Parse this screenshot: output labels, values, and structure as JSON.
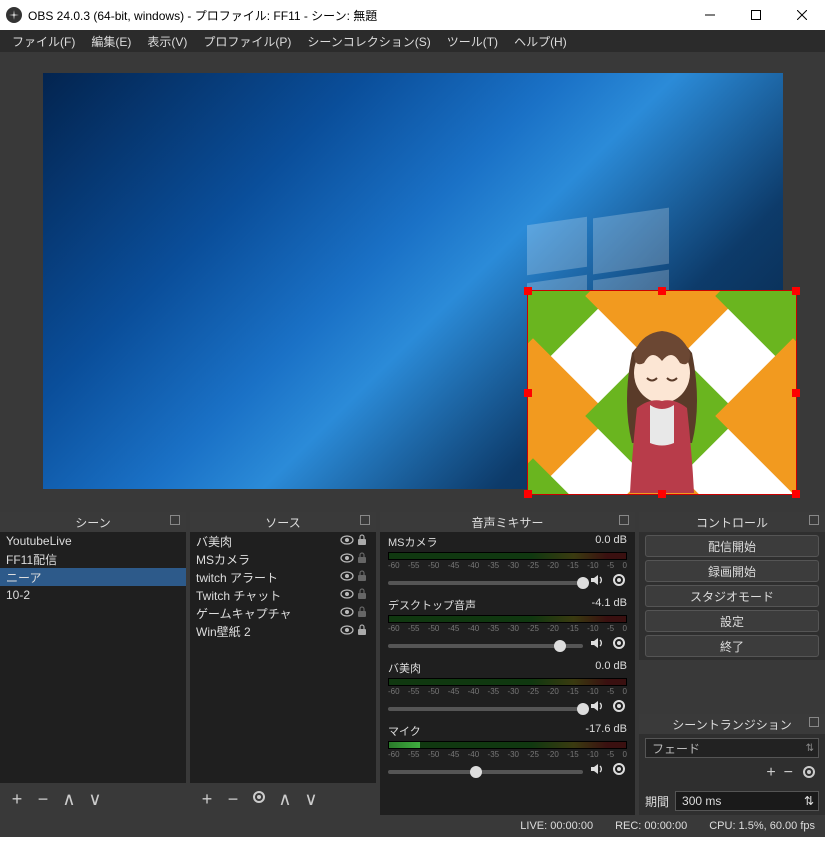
{
  "window": {
    "title": "OBS 24.0.3 (64-bit, windows) - プロファイル: FF11 - シーン: 無題"
  },
  "menu": {
    "file": "ファイル(F)",
    "edit": "編集(E)",
    "view": "表示(V)",
    "profile": "プロファイル(P)",
    "scene_collection": "シーンコレクション(S)",
    "tools": "ツール(T)",
    "help": "ヘルプ(H)"
  },
  "panels": {
    "scenes": {
      "title": "シーン",
      "items": [
        "YoutubeLive",
        "FF11配信",
        "ニーア",
        "10-2"
      ],
      "selected_index": 2
    },
    "sources": {
      "title": "ソース",
      "items": [
        {
          "label": "バ美肉",
          "visible": true,
          "locked": false
        },
        {
          "label": "MSカメラ",
          "visible": true,
          "locked": true
        },
        {
          "label": "twitch アラート",
          "visible": true,
          "locked": true
        },
        {
          "label": "Twitch チャット",
          "visible": true,
          "locked": true
        },
        {
          "label": "ゲームキャプチャ",
          "visible": true,
          "locked": true
        },
        {
          "label": "Win壁紙 2",
          "visible": true,
          "locked": false
        }
      ]
    },
    "mixer": {
      "title": "音声ミキサー",
      "ticks": [
        "-60",
        "-55",
        "-50",
        "-45",
        "-40",
        "-35",
        "-30",
        "-25",
        "-20",
        "-15",
        "-10",
        "-5",
        "0"
      ],
      "channels": [
        {
          "name": "MSカメラ",
          "db": "0.0 dB",
          "slider": 1.0,
          "level": 0.0
        },
        {
          "name": "デスクトップ音声",
          "db": "-4.1 dB",
          "slider": 0.88,
          "level": 0.0
        },
        {
          "name": "バ美肉",
          "db": "0.0 dB",
          "slider": 1.0,
          "level": 0.0
        },
        {
          "name": "マイク",
          "db": "-17.6 dB",
          "slider": 0.45,
          "level": 0.22
        }
      ]
    },
    "controls": {
      "title": "コントロール",
      "buttons": [
        "配信開始",
        "録画開始",
        "スタジオモード",
        "設定",
        "終了"
      ]
    },
    "transitions": {
      "title": "シーントランジション",
      "selected": "フェード",
      "duration_label": "期間",
      "duration_value": "300 ms"
    }
  },
  "status": {
    "live": "LIVE: 00:00:00",
    "rec": "REC: 00:00:00",
    "cpu": "CPU: 1.5%, 60.00 fps"
  }
}
